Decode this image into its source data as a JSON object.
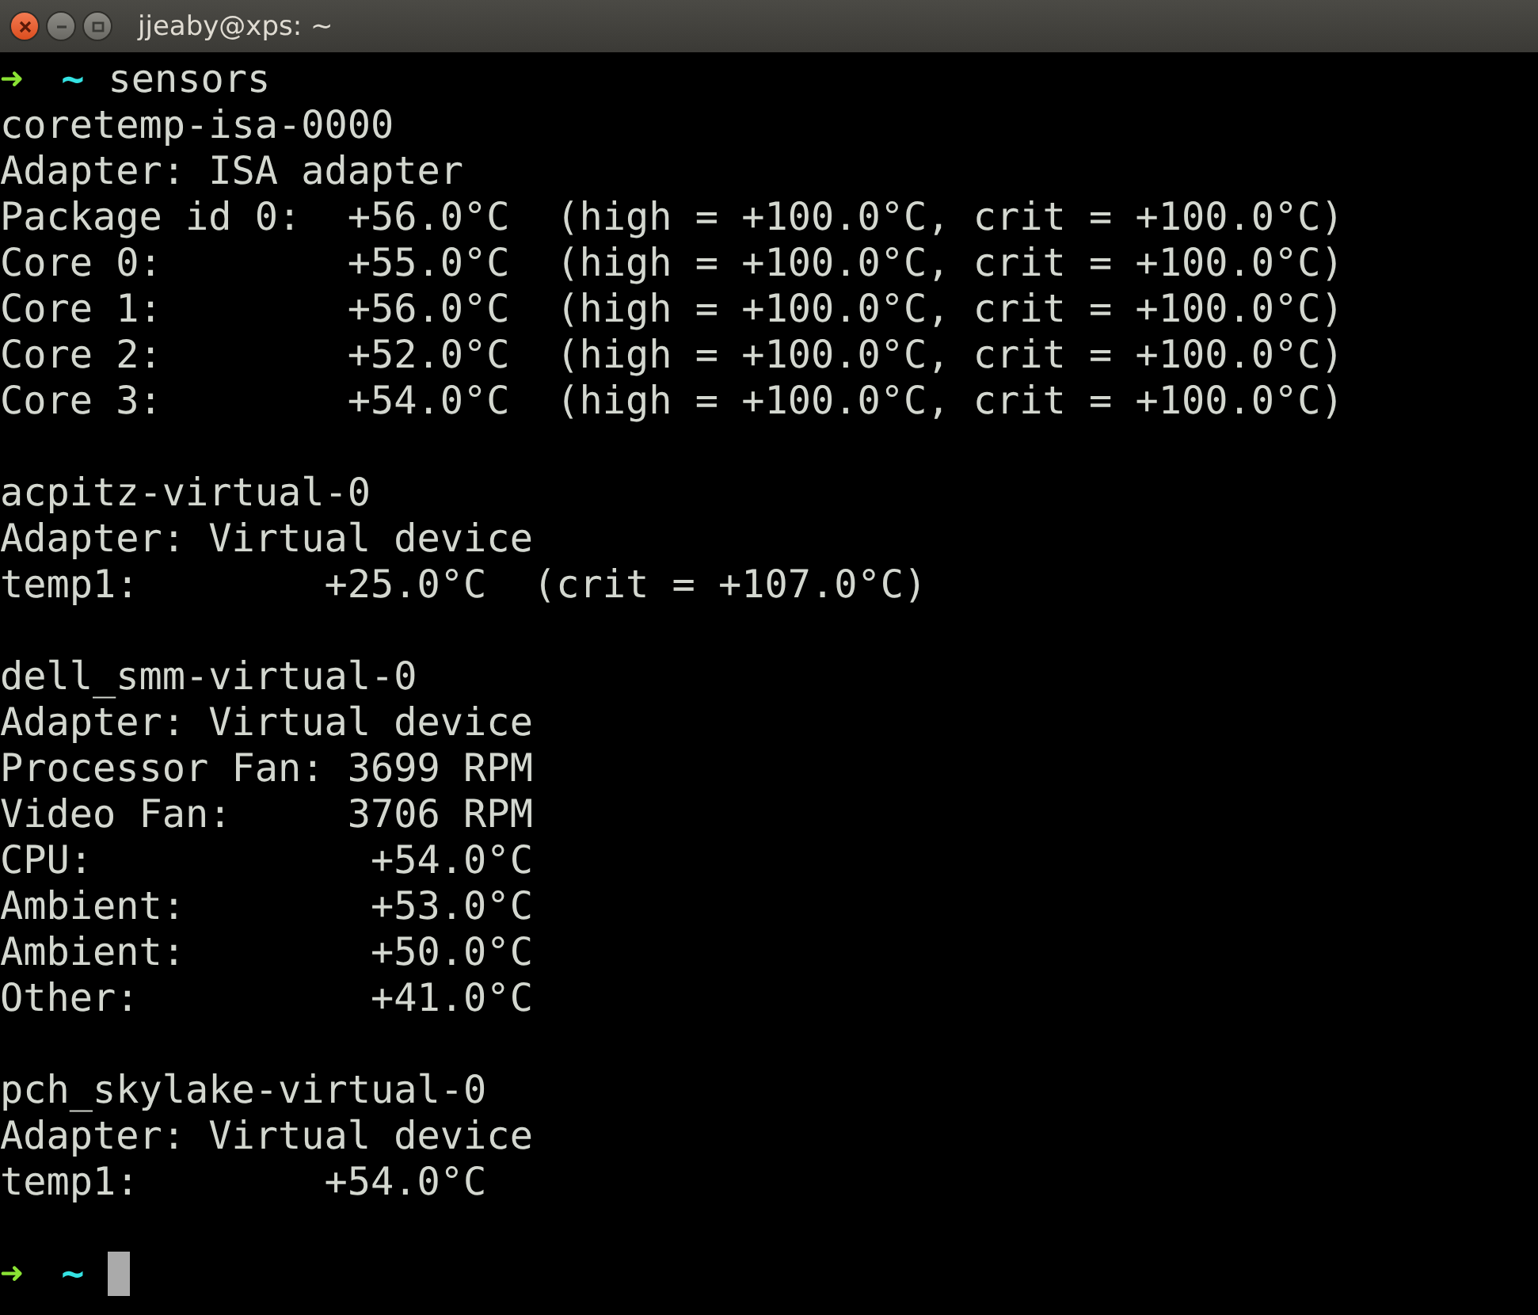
{
  "window": {
    "title": "jjeaby@xps: ~"
  },
  "terminal": {
    "prompt": {
      "arrow": "➜",
      "cwd": "~",
      "command": "sensors"
    },
    "blocks": [
      {
        "lines": [
          "coretemp-isa-0000",
          "Adapter: ISA adapter",
          "Package id 0:  +56.0°C  (high = +100.0°C, crit = +100.0°C)",
          "Core 0:        +55.0°C  (high = +100.0°C, crit = +100.0°C)",
          "Core 1:        +56.0°C  (high = +100.0°C, crit = +100.0°C)",
          "Core 2:        +52.0°C  (high = +100.0°C, crit = +100.0°C)",
          "Core 3:        +54.0°C  (high = +100.0°C, crit = +100.0°C)"
        ]
      },
      {
        "lines": [
          "acpitz-virtual-0",
          "Adapter: Virtual device",
          "temp1:        +25.0°C  (crit = +107.0°C)"
        ]
      },
      {
        "lines": [
          "dell_smm-virtual-0",
          "Adapter: Virtual device",
          "Processor Fan: 3699 RPM",
          "Video Fan:     3706 RPM",
          "CPU:            +54.0°C",
          "Ambient:        +53.0°C",
          "Ambient:        +50.0°C",
          "Other:          +41.0°C"
        ]
      },
      {
        "lines": [
          "pch_skylake-virtual-0",
          "Adapter: Virtual device",
          "temp1:        +54.0°C"
        ]
      }
    ],
    "final_prompt": {
      "arrow": "➜",
      "cwd": "~"
    }
  }
}
